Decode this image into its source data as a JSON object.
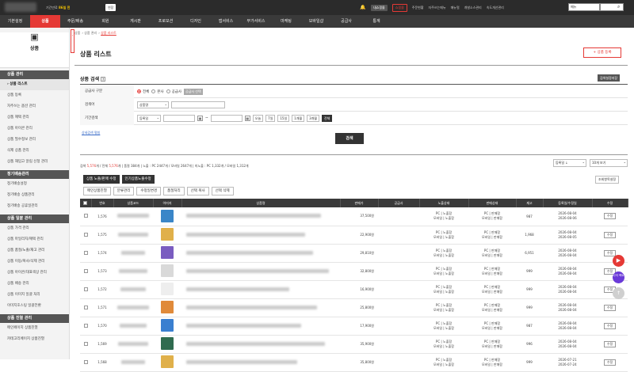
{
  "top": {
    "remain_label": "기간만료",
    "remain_value": "86일 전",
    "extend_label": "연장",
    "links": [
      "내쇼핑몰",
      "쇼핑몰",
      "주문현황",
      "자주쓰는메뉴",
      "매뉴얼",
      "개발소스관리",
      "속도개선관리"
    ],
    "search_select": "메뉴"
  },
  "gnb": [
    "기본설정",
    "상품",
    "주문/배송",
    "회원",
    "게시판",
    "프로모션",
    "디자인",
    "앱서비스",
    "부가서비스",
    "마케팅",
    "모바일샵",
    "공급사",
    "통계"
  ],
  "sidebar": {
    "title": "상품",
    "groups": [
      {
        "label": "상품 관리",
        "items": [
          "상품 리스트",
          "상품 등록",
          "자주쓰는 옵션 관리",
          "상품 혜택 관리",
          "상품 아이콘 관리",
          "상품 필수정보 관리",
          "삭제 상품 관리",
          "상품 재입고 알림 신청 관리"
        ]
      },
      {
        "label": "정기배송관리",
        "items": [
          "정기배송설정",
          "정기배송 상품관리",
          "정기배송 공휴일관리"
        ]
      },
      {
        "label": "상품 일괄 관리",
        "items": [
          "상품 가격 관리",
          "상품 마일리지/혜택 관리",
          "상품 품절/노출/재고 관리",
          "상품 이동/복사/삭제 관리",
          "상품 아이콘/대표색상 관리",
          "상품 배송 관리",
          "상품 이미지 일괄 처리",
          "이미지호스팅 일괄전환"
        ]
      },
      {
        "label": "상품 진열 관리",
        "items": [
          "메인페이지 상품진열",
          "카테고리페이지 상품진열"
        ]
      }
    ]
  },
  "breadcrumb": [
    "상품",
    "상품 관리",
    "상품 리스트"
  ],
  "page_title": "상품 리스트",
  "register_btn": "+ 상품 등록",
  "search": {
    "title": "상품 검색",
    "save_btn": "검색설정저장",
    "supplier_label": "공급사 구분",
    "supplier_opts": [
      "전체",
      "본사",
      "공급사"
    ],
    "supplier_btn": "공급사 선택",
    "keyword_label": "검색어",
    "keyword_select": "상품명",
    "period_label": "기간검색",
    "period_select": "등록일",
    "period_btns": [
      "오늘",
      "7일",
      "15일",
      "1개월",
      "3개월",
      "전체"
    ],
    "advanced": "상세검색 펼침",
    "submit": "검색"
  },
  "count_text": {
    "prefix": "검색",
    "found": "5,576",
    "mid": "개 / 전체",
    "total": "5,576",
    "rest": "개 | 품절 384개 | 노출 : PC 2447개 / 모바일 2647개 | 미노출 : PC 1,332개 / 모바일 1,312개"
  },
  "sort": {
    "order": "등록일 ↓",
    "per_page": "10개 보기"
  },
  "actions_primary": [
    "상품 노출/판매 수정",
    "인기상품노출수정"
  ],
  "actions_secondary": [
    "메인상품진열",
    "분류관리",
    "수정일변경",
    "품절처리",
    "선택 복사",
    "선택 삭제"
  ],
  "colset_btn": "조회항목설정",
  "table": {
    "headers": [
      "",
      "번호",
      "상품코드",
      "이미지",
      "상품명",
      "판매가",
      "공급사",
      "노출상태",
      "판매상태",
      "재고",
      "등록일/수정일",
      "수정"
    ],
    "rows": [
      {
        "no": "1,576",
        "price": "37,500원",
        "disp": [
          "PC | 노출함",
          "모바일 | 노출함"
        ],
        "sale": [
          "PC | 판매함",
          "모바일 | 판매함"
        ],
        "stock": "987",
        "reg": "2026-08-04",
        "mod": "2026-08-06",
        "edit": "수정",
        "color": "#3a86c8"
      },
      {
        "no": "1,575",
        "price": "22,900원",
        "disp": [
          "PC | 노출함",
          "모바일 | 노출함"
        ],
        "sale": [
          "PC | 판매함",
          "모바일 | 판매함"
        ],
        "stock": "1,968",
        "reg": "2026-08-04",
        "mod": "2026-08-05",
        "edit": "수정",
        "color": "#e0b04a"
      },
      {
        "no": "1,574",
        "price": "29,810원",
        "disp": [
          "PC | 노출함",
          "모바일 | 노출함"
        ],
        "sale": [
          "PC | 판매함",
          "모바일 | 판매함"
        ],
        "stock": "6,951",
        "reg": "2026-08-04",
        "mod": "2026-08-04",
        "edit": "수정",
        "color": "#7a5cc0"
      },
      {
        "no": "1,573",
        "price": "32,800원",
        "disp": [
          "PC | 노출함",
          "모바일 | 노출함"
        ],
        "sale": [
          "PC | 판매함",
          "모바일 | 판매함"
        ],
        "stock": "999",
        "reg": "2026-08-04",
        "mod": "2026-08-04",
        "edit": "수정",
        "color": "#d9d9d9"
      },
      {
        "no": "1,572",
        "price": "16,900원",
        "disp": [
          "PC | 노출함",
          "모바일 | 노출함"
        ],
        "sale": [
          "PC | 판매함",
          "모바일 | 판매함"
        ],
        "stock": "999",
        "reg": "2026-08-04",
        "mod": "2026-08-04",
        "edit": "수정",
        "color": "#eeeeee"
      },
      {
        "no": "1,571",
        "price": "25,800원",
        "disp": [
          "PC | 노출함",
          "모바일 | 노출함"
        ],
        "sale": [
          "PC | 판매함",
          "모바일 | 판매함"
        ],
        "stock": "999",
        "reg": "2026-08-04",
        "mod": "2026-08-04",
        "edit": "수정",
        "color": "#e08a3a"
      },
      {
        "no": "1,570",
        "price": "17,900원",
        "disp": [
          "PC | 노출함",
          "모바일 | 노출함"
        ],
        "sale": [
          "PC | 판매함",
          "모바일 | 판매함"
        ],
        "stock": "987",
        "reg": "2026-08-04",
        "mod": "2026-08-04",
        "edit": "수정",
        "color": "#3a7fd0"
      },
      {
        "no": "1,569",
        "price": "35,900원",
        "disp": [
          "PC | 노출함",
          "모바일 | 노출함"
        ],
        "sale": [
          "PC | 판매함",
          "모바일 | 판매함"
        ],
        "stock": "996",
        "reg": "2026-08-04",
        "mod": "2026-08-04",
        "edit": "수정",
        "color": "#2f6b4f"
      },
      {
        "no": "1,568",
        "price": "35,800원",
        "disp": [
          "PC | 노출함",
          "모바일 | 노출함"
        ],
        "sale": [
          "PC | 판매함",
          "모바일 | 판매함"
        ],
        "stock": "999",
        "reg": "2026-07-21",
        "mod": "2026-07-24",
        "edit": "수정",
        "color": "#e0b04a"
      }
    ]
  },
  "floating": {
    "youtube": "▶",
    "plus": "다이\n렉트",
    "up": "↑"
  }
}
